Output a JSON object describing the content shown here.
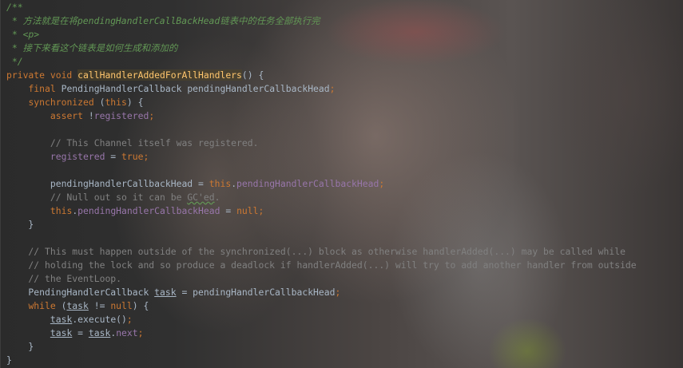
{
  "editor": {
    "lines": [
      [
        {
          "t": "/**",
          "c": "doc"
        }
      ],
      [
        {
          "t": " * 方法就是在将pendingHandlerCallBackHead链表中的任务全部执行完",
          "c": "doc"
        }
      ],
      [
        {
          "t": " * <p>",
          "c": "doc"
        }
      ],
      [
        {
          "t": " * 接下来看这个链表是如何生成和添加的",
          "c": "doc"
        }
      ],
      [
        {
          "t": " */",
          "c": "doc"
        }
      ],
      [
        {
          "t": "private void ",
          "c": "kw"
        },
        {
          "t": "callHandlerAddedForAllHandlers",
          "c": "fn"
        },
        {
          "t": "() {",
          "c": ""
        }
      ],
      [
        {
          "t": "    ",
          "c": ""
        },
        {
          "t": "final ",
          "c": "kw"
        },
        {
          "t": "PendingHandlerCallback pendingHandlerCallbackHead",
          "c": ""
        },
        {
          "t": ";",
          "c": "kw"
        }
      ],
      [
        {
          "t": "    ",
          "c": ""
        },
        {
          "t": "synchronized ",
          "c": "kw"
        },
        {
          "t": "(",
          "c": ""
        },
        {
          "t": "this",
          "c": "kw"
        },
        {
          "t": ") {",
          "c": ""
        }
      ],
      [
        {
          "t": "        ",
          "c": ""
        },
        {
          "t": "assert ",
          "c": "kw"
        },
        {
          "t": "!",
          "c": ""
        },
        {
          "t": "registered",
          "c": "fld"
        },
        {
          "t": ";",
          "c": "kw"
        }
      ],
      [
        {
          "t": "",
          "c": ""
        }
      ],
      [
        {
          "t": "        // This Channel itself was registered.",
          "c": "cm"
        }
      ],
      [
        {
          "t": "        ",
          "c": ""
        },
        {
          "t": "registered",
          "c": "fld"
        },
        {
          "t": " = ",
          "c": ""
        },
        {
          "t": "true",
          "c": "kw"
        },
        {
          "t": ";",
          "c": "kw"
        }
      ],
      [
        {
          "t": "",
          "c": ""
        }
      ],
      [
        {
          "t": "        pendingHandlerCallbackHead = ",
          "c": ""
        },
        {
          "t": "this",
          "c": "kw"
        },
        {
          "t": ".",
          "c": ""
        },
        {
          "t": "pendingHandlerCallbackHead",
          "c": "fld"
        },
        {
          "t": ";",
          "c": "kw"
        }
      ],
      [
        {
          "t": "        // Null out so it can be ",
          "c": "cm"
        },
        {
          "t": "GC'ed",
          "c": "cm squig"
        },
        {
          "t": ".",
          "c": "cm"
        }
      ],
      [
        {
          "t": "        ",
          "c": ""
        },
        {
          "t": "this",
          "c": "kw"
        },
        {
          "t": ".",
          "c": ""
        },
        {
          "t": "pendingHandlerCallbackHead",
          "c": "fld"
        },
        {
          "t": " = ",
          "c": ""
        },
        {
          "t": "null",
          "c": "kw"
        },
        {
          "t": ";",
          "c": "kw"
        }
      ],
      [
        {
          "t": "    }",
          "c": ""
        }
      ],
      [
        {
          "t": "",
          "c": ""
        }
      ],
      [
        {
          "t": "    // This must happen outside of the synchronized(...) block as otherwise handlerAdded(...) may be called while",
          "c": "cm"
        }
      ],
      [
        {
          "t": "    // holding the lock and so produce a deadlock if handlerAdded(...) will try to add another handler from outside",
          "c": "cm"
        }
      ],
      [
        {
          "t": "    // the EventLoop.",
          "c": "cm"
        }
      ],
      [
        {
          "t": "    PendingHandlerCallback ",
          "c": ""
        },
        {
          "t": "task",
          "c": "lv"
        },
        {
          "t": " = pendingHandlerCallbackHead",
          "c": ""
        },
        {
          "t": ";",
          "c": "kw"
        }
      ],
      [
        {
          "t": "    ",
          "c": ""
        },
        {
          "t": "while ",
          "c": "kw"
        },
        {
          "t": "(",
          "c": ""
        },
        {
          "t": "task",
          "c": "lv"
        },
        {
          "t": " != ",
          "c": ""
        },
        {
          "t": "null",
          "c": "kw"
        },
        {
          "t": ") {",
          "c": ""
        }
      ],
      [
        {
          "t": "        ",
          "c": ""
        },
        {
          "t": "task",
          "c": "lv"
        },
        {
          "t": ".execute()",
          "c": ""
        },
        {
          "t": ";",
          "c": "kw"
        }
      ],
      [
        {
          "t": "        ",
          "c": ""
        },
        {
          "t": "task",
          "c": "lv"
        },
        {
          "t": " = ",
          "c": ""
        },
        {
          "t": "task",
          "c": "lv"
        },
        {
          "t": ".",
          "c": ""
        },
        {
          "t": "next",
          "c": "fld"
        },
        {
          "t": ";",
          "c": "kw"
        }
      ],
      [
        {
          "t": "    }",
          "c": ""
        }
      ],
      [
        {
          "t": "}",
          "c": ""
        }
      ]
    ]
  }
}
